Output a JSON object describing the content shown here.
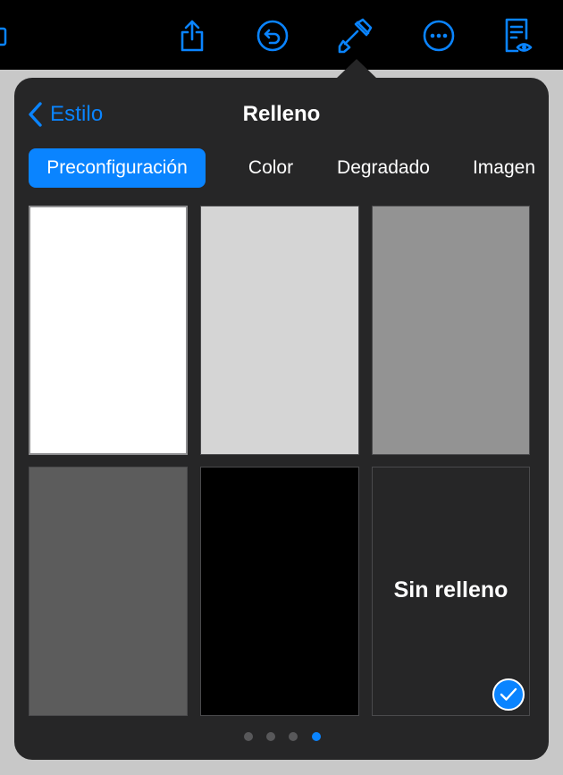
{
  "colors": {
    "accent": "#0a84ff",
    "popover_bg": "#262627",
    "toolbar_bg": "#000000"
  },
  "toolbar": {
    "icons": [
      "share-icon",
      "undo-icon",
      "format-brush-icon",
      "more-icon",
      "reading-view-icon"
    ],
    "active_icon": "format-brush-icon"
  },
  "popover": {
    "back_label": "Estilo",
    "title": "Relleno",
    "tabs": [
      {
        "label": "Preconfiguración",
        "active": true
      },
      {
        "label": "Color",
        "active": false
      },
      {
        "label": "Degradado",
        "active": false
      },
      {
        "label": "Imagen",
        "active": false
      }
    ],
    "swatches": [
      {
        "color": "#ffffff"
      },
      {
        "color": "#d5d5d5"
      },
      {
        "color": "#939393"
      },
      {
        "color": "#5c5c5c"
      },
      {
        "color": "#000000"
      },
      {
        "color": "#262627",
        "label": "Sin relleno",
        "selected": true
      }
    ],
    "page_count": 4,
    "current_page": 4
  }
}
